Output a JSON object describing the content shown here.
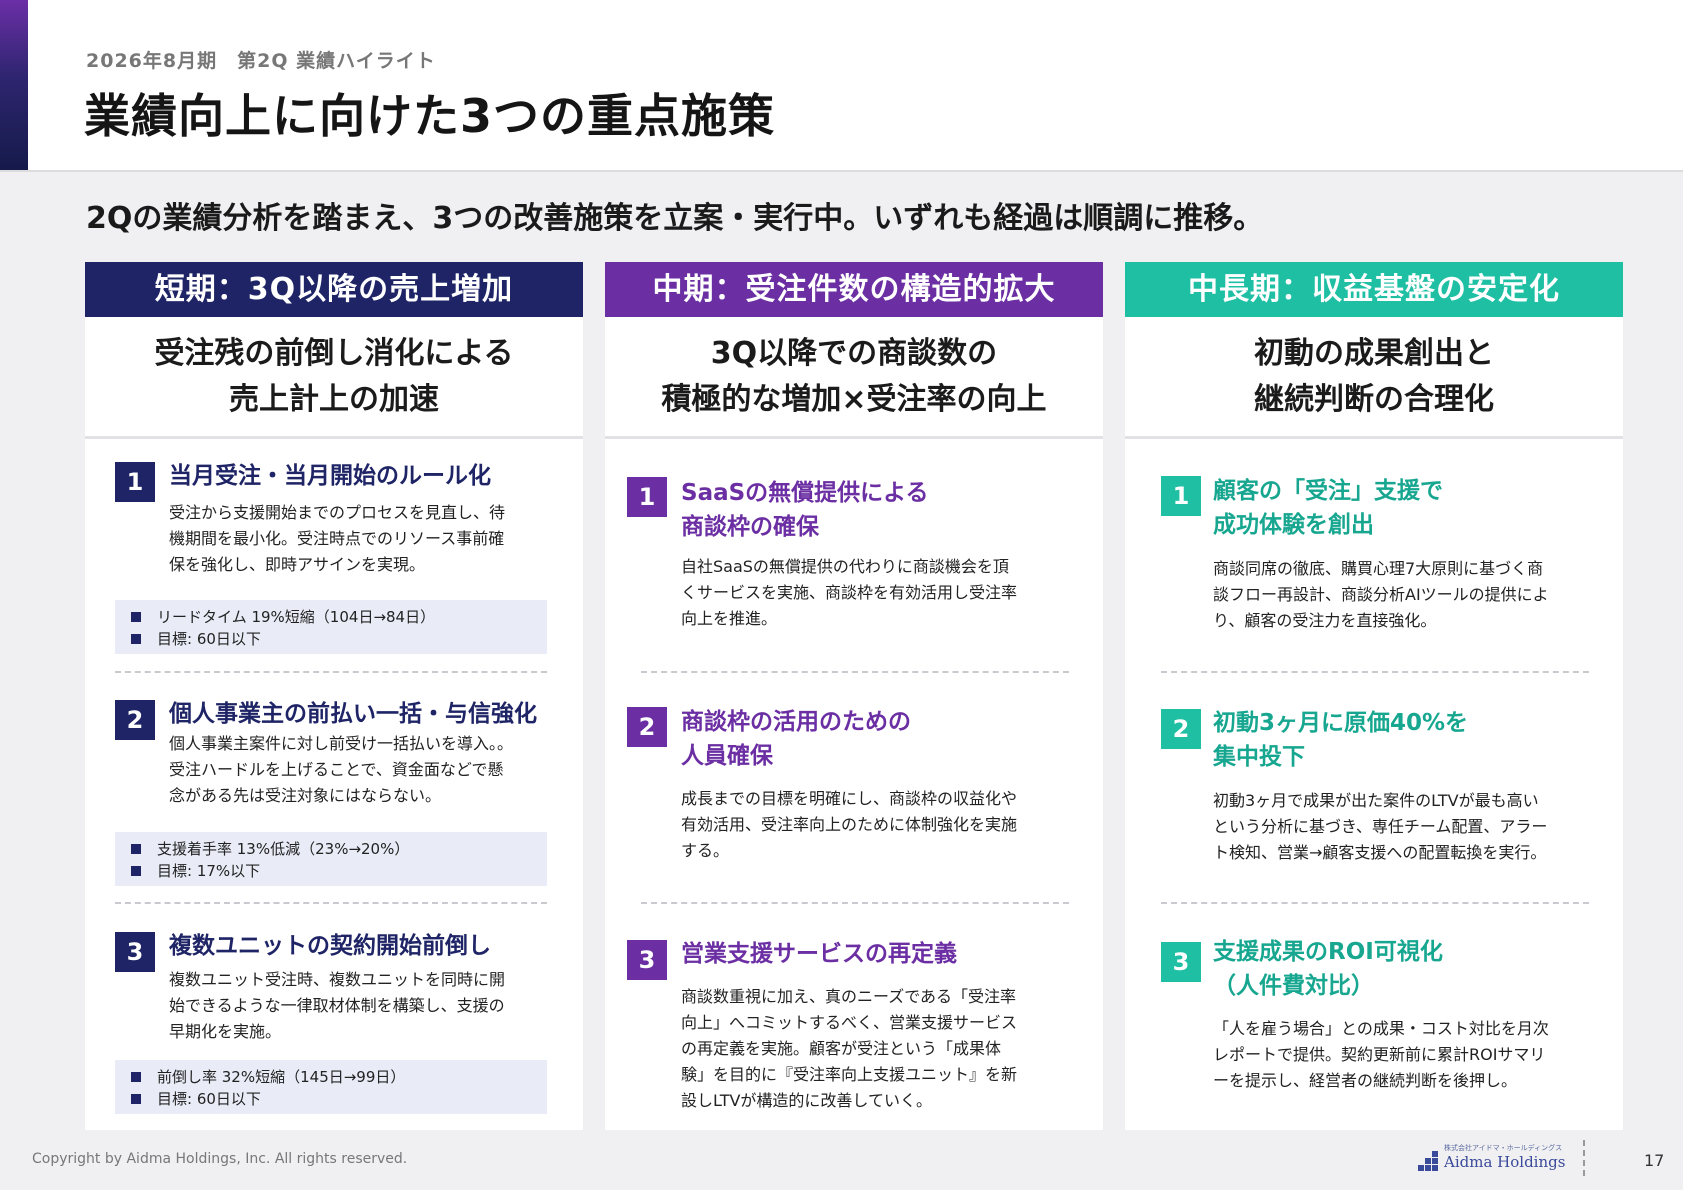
{
  "header": {
    "subtitle": "2026年8月期　第2Q 業績ハイライト",
    "title": "業績向上に向けた3つの重点施策"
  },
  "lead": "2Qの業績分析を踏まえ、3つの改善施策を立案・実行中。いずれも経過は順調に推移。",
  "columns": [
    {
      "header": "短期：3Q以降の売上増加",
      "color": "#1e2466",
      "subheading": [
        "受注残の前倒し消化による",
        "売上計上の加速"
      ],
      "items": [
        {
          "num": "1",
          "title": [
            "当月受注・当月開始のルール化"
          ],
          "body": [
            "受注から支援開始までのプロセスを見直し、待",
            "機期間を最小化。受注時点でのリソース事前確",
            "保を強化し、即時アサインを実現。"
          ],
          "kpi": [
            "リードタイム 19%短縮（104日→84日）",
            "目標: 60日以下"
          ]
        },
        {
          "num": "2",
          "title": [
            "個人事業主の前払い一括・与信強化"
          ],
          "body": [
            "個人事業主案件に対し前受け一括払いを導入。。",
            "受注ハードルを上げることで、資金面などで懸",
            "念がある先は受注対象にはならない。"
          ],
          "kpi": [
            "支援着手率 13%低減（23%→20%）",
            "目標: 17%以下"
          ]
        },
        {
          "num": "3",
          "title": [
            "複数ユニットの契約開始前倒し"
          ],
          "body": [
            "複数ユニット受注時、複数ユニットを同時に開",
            "始できるような一律取材体制を構築し、支援の",
            "早期化を実施。"
          ],
          "kpi": [
            "前倒し率 32%短縮（145日→99日）",
            "目標: 60日以下"
          ]
        }
      ]
    },
    {
      "header": "中期：受注件数の構造的拡大",
      "color": "#6b2fa3",
      "subheading": [
        "3Q以降での商談数の",
        "積極的な増加×受注率の向上"
      ],
      "items": [
        {
          "num": "1",
          "title": [
            "SaaSの無償提供による",
            "商談枠の確保"
          ],
          "body": [
            "自社SaaSの無償提供の代わりに商談機会を頂",
            "くサービスを実施、商談枠を有効活用し受注率",
            "向上を推進。"
          ]
        },
        {
          "num": "2",
          "title": [
            "商談枠の活用のための",
            "人員確保"
          ],
          "body": [
            "成長までの目標を明確にし、商談枠の収益化や",
            "有効活用、受注率向上のために体制強化を実施",
            "する。"
          ]
        },
        {
          "num": "3",
          "title": [
            "営業支援サービスの再定義"
          ],
          "body": [
            "商談数重視に加え、真のニーズである「受注率",
            "向上」へコミットするべく、営業支援サービス",
            "の再定義を実施。顧客が受注という「成果体",
            "験」を目的に『受注率向上支援ユニット』を新",
            "設しLTVが構造的に改善していく。"
          ]
        }
      ]
    },
    {
      "header": "中長期：収益基盤の安定化",
      "color": "#1fbfa4",
      "subheading": [
        "初動の成果創出と",
        "継続判断の合理化"
      ],
      "items": [
        {
          "num": "1",
          "title": [
            "顧客の「受注」支援で",
            "成功体験を創出"
          ],
          "body": [
            "商談同席の徹底、購買心理7大原則に基づく商",
            "談フロー再設計、商談分析AIツールの提供によ",
            "り、顧客の受注力を直接強化。"
          ]
        },
        {
          "num": "2",
          "title": [
            "初動3ヶ月に原価40%を",
            "集中投下"
          ],
          "body": [
            "初動3ヶ月で成果が出た案件のLTVが最も高い",
            "という分析に基づき、専任チーム配置、アラー",
            "ト検知、営業→顧客支援への配置転換を実行。"
          ]
        },
        {
          "num": "3",
          "title": [
            "支援成果のROI可視化",
            "（人件費対比）"
          ],
          "body": [
            "「人を雇う場合」との成果・コスト対比を月次",
            "レポートで提供。契約更新前に累計ROIサマリ",
            "ーを提示し、経営者の継続判断を後押し。"
          ]
        }
      ]
    }
  ],
  "footer": {
    "copyright": "Copyright by Aidma Holdings, Inc. All rights reserved.",
    "logo_small": "株式会社アイドマ・ホールディングス",
    "logo_text": "Aidma Holdings",
    "page": "17"
  }
}
